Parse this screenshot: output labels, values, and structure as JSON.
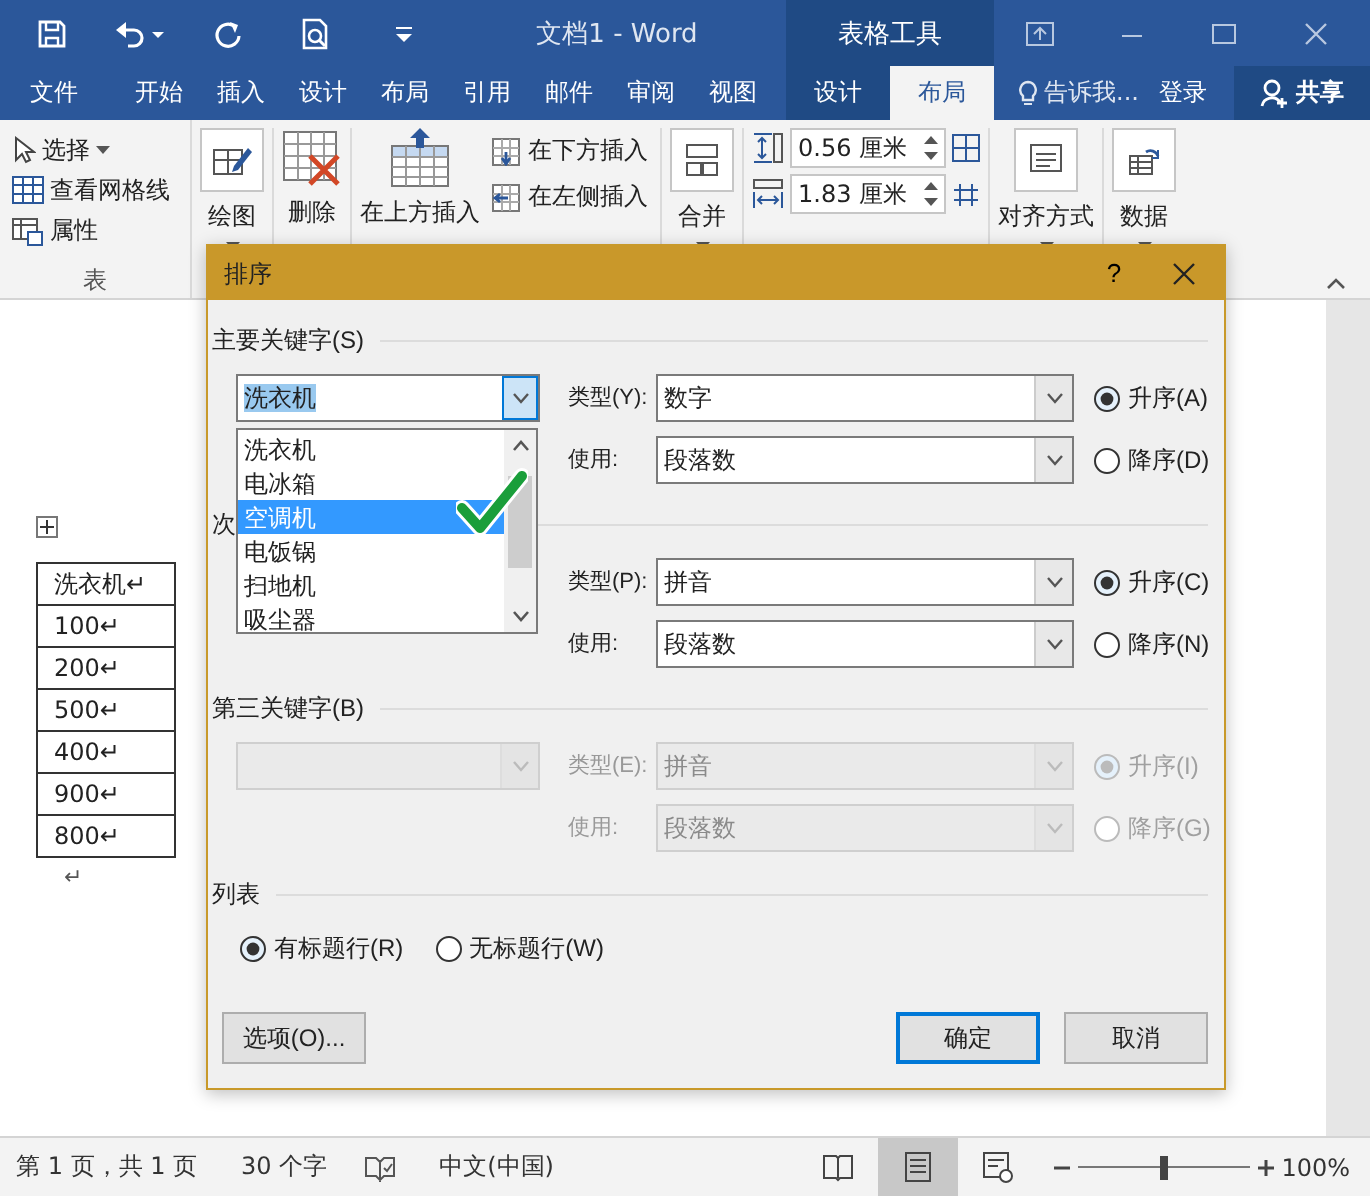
{
  "window": {
    "title": "文档1 - Word",
    "context_group": "表格工具"
  },
  "tabs": [
    {
      "label": "文件",
      "selected": false,
      "contextual": false
    },
    {
      "label": "开始",
      "selected": false,
      "contextual": false
    },
    {
      "label": "插入",
      "selected": false,
      "contextual": false
    },
    {
      "label": "设计",
      "selected": false,
      "contextual": false
    },
    {
      "label": "布局",
      "selected": false,
      "contextual": false
    },
    {
      "label": "引用",
      "selected": false,
      "contextual": false
    },
    {
      "label": "邮件",
      "selected": false,
      "contextual": false
    },
    {
      "label": "审阅",
      "selected": false,
      "contextual": false
    },
    {
      "label": "视图",
      "selected": false,
      "contextual": false
    }
  ],
  "context_tabs": [
    {
      "label": "设计",
      "selected": false
    },
    {
      "label": "布局",
      "selected": true
    }
  ],
  "tell_me": "告诉我...",
  "sign_in": "登录",
  "share": "共享",
  "ribbon": {
    "table_group": {
      "label": "表",
      "items": [
        {
          "kind": "select",
          "label": "选择",
          "dropdown": true
        },
        {
          "kind": "gridlines",
          "label": "查看网格线",
          "dropdown": false
        },
        {
          "kind": "properties",
          "label": "属性",
          "dropdown": false
        }
      ]
    },
    "commands": [
      {
        "kind": "draw",
        "label": "绘图",
        "dropdown": true
      },
      {
        "kind": "delete",
        "label": "删除",
        "dropdown": false
      },
      {
        "kind": "insert_above",
        "label": "在上方插入",
        "dropdown": false
      }
    ],
    "insert_small": [
      {
        "kind": "insert_below",
        "label": "在下方插入"
      },
      {
        "kind": "insert_left",
        "label": "在左侧插入"
      }
    ],
    "merge": {
      "label": "合并",
      "dropdown": true
    },
    "cell_size": [
      {
        "kind": "height",
        "value": "0.56 厘米"
      },
      {
        "kind": "width",
        "value": "1.83 厘米"
      }
    ],
    "alignment": {
      "label": "对齐方式",
      "dropdown": true
    },
    "data": {
      "label": "数据",
      "dropdown": true
    }
  },
  "document": {
    "table": {
      "rows": [
        "洗衣机↵",
        "100↵",
        "200↵",
        "500↵",
        "400↵",
        "900↵",
        "800↵"
      ]
    },
    "end_mark": "↵"
  },
  "dialog": {
    "title": "排序",
    "help": "?",
    "keys": [
      {
        "label": "主要关键字(S)",
        "disabled": false,
        "field": {
          "value": "洗衣机",
          "open": true
        },
        "type_label": "类型(Y):",
        "type": "数字",
        "using_label": "使用:",
        "using": "段落数",
        "order": [
          {
            "label": "升序(A)",
            "selected": true
          },
          {
            "label": "降序(D)",
            "selected": false
          }
        ]
      },
      {
        "label": "次",
        "disabled": false,
        "type_label": "类型(P):",
        "type": "拼音",
        "using_label": "使用:",
        "using": "段落数",
        "order": [
          {
            "label": "升序(C)",
            "selected": true
          },
          {
            "label": "降序(N)",
            "selected": false
          }
        ]
      },
      {
        "label": "第三关键字(B)",
        "disabled": true,
        "field": {
          "open": false
        },
        "type_label": "类型(E):",
        "type": "拼音",
        "using_label": "使用:",
        "using": "段落数",
        "order": [
          {
            "label": "升序(I)",
            "selected": true
          },
          {
            "label": "降序(G)",
            "selected": false
          }
        ]
      }
    ],
    "dropdown": {
      "options": [
        {
          "label": "洗衣机",
          "selected": false
        },
        {
          "label": "电冰箱",
          "selected": false
        },
        {
          "label": "空调机",
          "selected": true
        },
        {
          "label": "电饭锅",
          "selected": false
        },
        {
          "label": "扫地机",
          "selected": false
        },
        {
          "label": "吸尘器",
          "selected": false
        }
      ]
    },
    "list_section": {
      "label": "列表",
      "options": [
        {
          "label": "有标题行(R)",
          "selected": true
        },
        {
          "label": "无标题行(W)",
          "selected": false
        }
      ]
    },
    "buttons": [
      {
        "label": "选项(O)...",
        "kind": "options",
        "default": false
      },
      {
        "label": "确定",
        "kind": "ok",
        "default": true
      },
      {
        "label": "取消",
        "kind": "cancel",
        "default": false
      }
    ]
  },
  "status_bar": {
    "page": "第 1 页，共 1 页",
    "words": "30 个字",
    "language": "中文(中国)",
    "views": [
      {
        "kind": "read",
        "selected": false
      },
      {
        "kind": "print",
        "selected": true
      },
      {
        "kind": "web",
        "selected": false
      }
    ],
    "zoom_slider": {
      "level": 0.5
    },
    "zoom": "100%"
  }
}
